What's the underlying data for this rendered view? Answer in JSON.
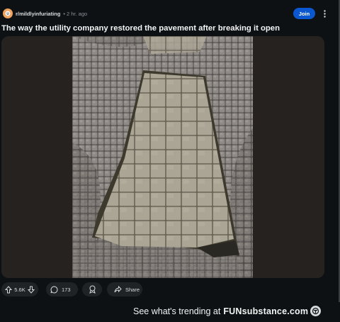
{
  "post": {
    "subreddit": "r/mildlyinfuriating",
    "separator": "•",
    "age": "2 hr. ago",
    "join_label": "Join",
    "title": "The way the utility company restored the pavement after breaking it open"
  },
  "actions": {
    "vote_count": "5.6K",
    "comment_count": "173",
    "share_label": "Share"
  },
  "footer": {
    "text": "See what's trending at",
    "brand": "FUNsubstance.com"
  },
  "colors": {
    "join_button": "#0b57d0",
    "background": "#0e1113",
    "pill": "#1f2326"
  }
}
